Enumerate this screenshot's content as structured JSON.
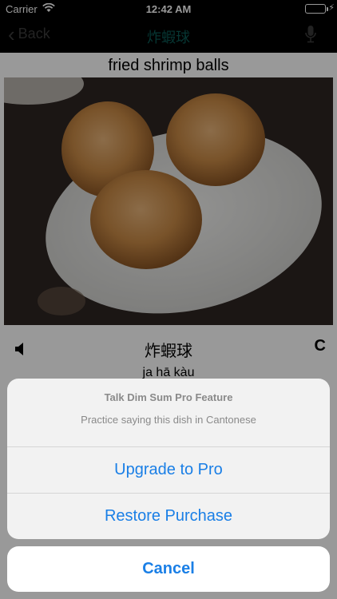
{
  "status_bar": {
    "carrier": "Carrier",
    "time": "12:42 AM",
    "battery_level": 1.0,
    "battery_color": "#4cd964"
  },
  "nav": {
    "back_label": "Back",
    "title": "炸蝦球",
    "back_icon": "chevron-left-icon",
    "mic_icon": "microphone-icon"
  },
  "dish": {
    "english_name": "fried shrimp balls",
    "chinese_name": "炸蝦球",
    "jyutping": "ja hā kàu",
    "c_label": "C",
    "speaker_icon": "speaker-icon"
  },
  "sheet": {
    "title": "Talk Dim Sum Pro Feature",
    "message": "Practice saying this dish in Cantonese",
    "upgrade_label": "Upgrade to Pro",
    "restore_label": "Restore Purchase",
    "cancel_label": "Cancel",
    "accent_color": "#1a7fe6"
  }
}
